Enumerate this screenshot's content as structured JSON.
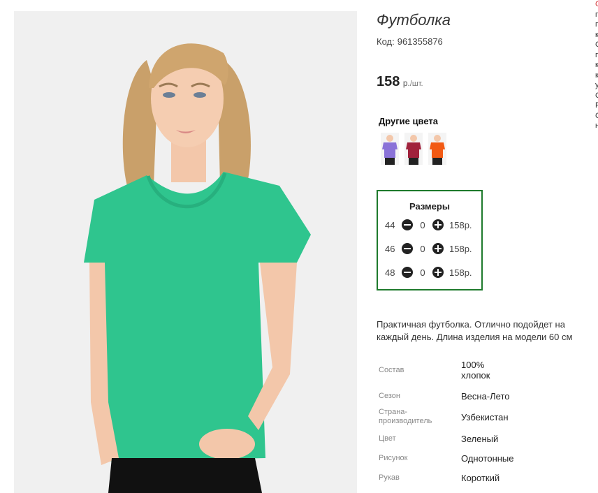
{
  "product": {
    "title": "Футболка",
    "code_label": "Код:",
    "code": "961355876",
    "price": "158",
    "currency": "р.",
    "per": "/шт."
  },
  "colors": {
    "heading": "Другие цвета",
    "items": [
      {
        "name": "purple",
        "color": "#8a72d8"
      },
      {
        "name": "burgundy",
        "color": "#a0223c"
      },
      {
        "name": "orange",
        "color": "#f25a14"
      }
    ],
    "current": "#2fc58e"
  },
  "sizes": {
    "heading": "Размеры",
    "rows": [
      {
        "size": "44",
        "qty": "0",
        "price": "158р."
      },
      {
        "size": "46",
        "qty": "0",
        "price": "158р."
      },
      {
        "size": "48",
        "qty": "0",
        "price": "158р."
      }
    ]
  },
  "description": "Практичная футболка. Отлично подойдет на каждый день. Длина изделия на модели 60 см",
  "properties": [
    {
      "key": "Состав",
      "value": "100% хлопок"
    },
    {
      "key": "Сезон",
      "value": "Весна-Лето"
    },
    {
      "key": "Страна-производитель",
      "value": "Узбекистан"
    },
    {
      "key": "Цвет",
      "value": "Зеленый"
    },
    {
      "key": "Рисунок",
      "value": "Однотонные"
    },
    {
      "key": "Рукав",
      "value": "Короткий"
    }
  ],
  "edge_letters": [
    "С",
    "п",
    "п",
    "к",
    "С",
    "п",
    "к",
    "к",
    "у",
    "С",
    "Р",
    "С",
    "н"
  ]
}
